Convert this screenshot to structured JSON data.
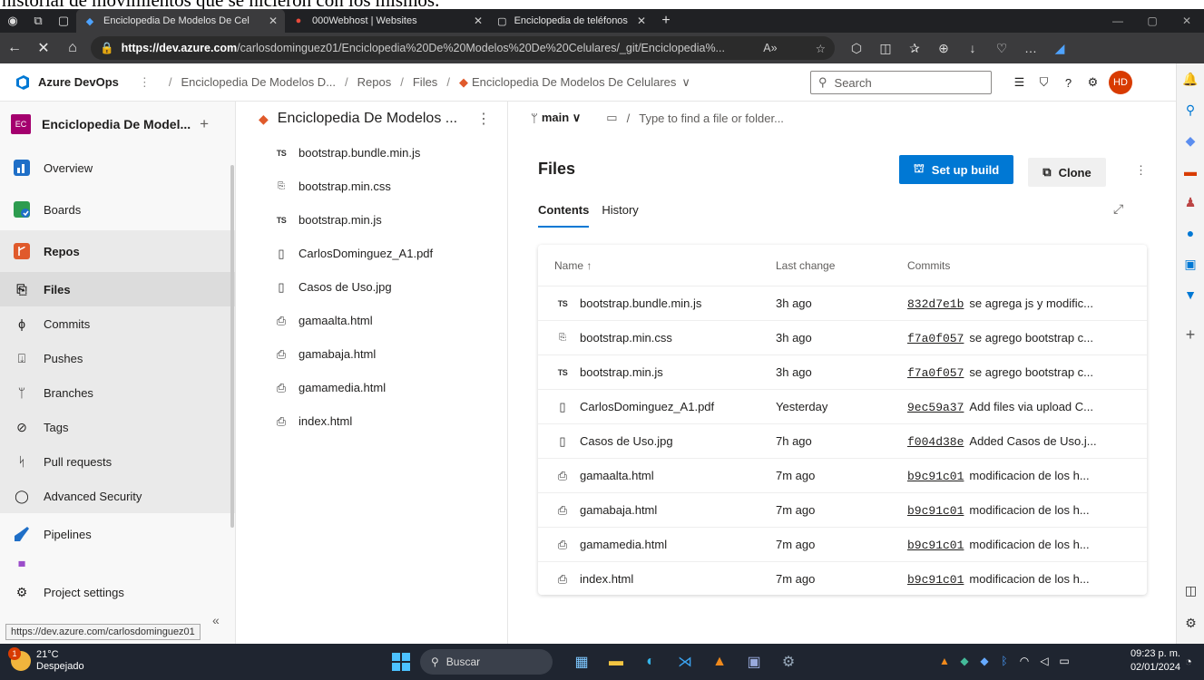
{
  "doc_strip": "historial de movimientos que se hicieron con los mismos.",
  "browser": {
    "tabs": [
      {
        "label": "Enciclopedia De Modelos De Cel"
      },
      {
        "label": "000Webhost | Websites"
      },
      {
        "label": "Enciclopedia de teléfonos"
      }
    ],
    "url_host": "https://dev.azure.com",
    "url_path": "/carlosdominguez01/Enciclopedia%20De%20Modelos%20De%20Celulares/_git/Enciclopedia%..."
  },
  "header": {
    "product": "Azure DevOps",
    "breadcrumb": [
      "Enciclopedia De Modelos D...",
      "Repos",
      "Files",
      "Enciclopedia De Modelos De Celulares"
    ],
    "search_placeholder": "Search",
    "avatar": "HD"
  },
  "sidebar": {
    "project_initials": "EC",
    "project_name": "Enciclopedia De Model...",
    "items": [
      {
        "label": "Overview"
      },
      {
        "label": "Boards"
      },
      {
        "label": "Repos"
      },
      {
        "label": "Files"
      },
      {
        "label": "Commits"
      },
      {
        "label": "Pushes"
      },
      {
        "label": "Branches"
      },
      {
        "label": "Tags"
      },
      {
        "label": "Pull requests"
      },
      {
        "label": "Advanced Security"
      },
      {
        "label": "Pipelines"
      }
    ],
    "settings": "Project settings",
    "tooltip": "https://dev.azure.com/carlosdominguez01"
  },
  "tree": {
    "repo_name": "Enciclopedia De Modelos ...",
    "files": [
      {
        "icon": "TS",
        "name": "bootstrap.bundle.min.js"
      },
      {
        "icon": "css",
        "name": "bootstrap.min.css"
      },
      {
        "icon": "TS",
        "name": "bootstrap.min.js"
      },
      {
        "icon": "file",
        "name": "CarlosDominguez_A1.pdf"
      },
      {
        "icon": "file",
        "name": "Casos de Uso.jpg"
      },
      {
        "icon": "html",
        "name": "gamaalta.html"
      },
      {
        "icon": "html",
        "name": "gamabaja.html"
      },
      {
        "icon": "html",
        "name": "gamamedia.html"
      },
      {
        "icon": "html",
        "name": "index.html"
      }
    ]
  },
  "main": {
    "branch": "main",
    "path_placeholder": "Type to find a file or folder...",
    "title": "Files",
    "setup_build": "Set up build",
    "clone": "Clone",
    "tabs": [
      "Contents",
      "History"
    ],
    "columns": [
      "Name ↑",
      "Last change",
      "Commits"
    ],
    "rows": [
      {
        "name": "bootstrap.bundle.min.js",
        "change": "3h ago",
        "hash": "832d7e1b",
        "msg": "se agrega js y modific..."
      },
      {
        "name": "bootstrap.min.css",
        "change": "3h ago",
        "hash": "f7a0f057",
        "msg": "se agrego bootstrap c..."
      },
      {
        "name": "bootstrap.min.js",
        "change": "3h ago",
        "hash": "f7a0f057",
        "msg": "se agrego bootstrap c..."
      },
      {
        "name": "CarlosDominguez_A1.pdf",
        "change": "Yesterday",
        "hash": "9ec59a37",
        "msg": "Add files via upload C..."
      },
      {
        "name": "Casos de Uso.jpg",
        "change": "7h ago",
        "hash": "f004d38e",
        "msg": "Added Casos de Uso.j..."
      },
      {
        "name": "gamaalta.html",
        "change": "7m ago",
        "hash": "b9c91c01",
        "msg": "modificacion de los h..."
      },
      {
        "name": "gamabaja.html",
        "change": "7m ago",
        "hash": "b9c91c01",
        "msg": "modificacion de los h..."
      },
      {
        "name": "gamamedia.html",
        "change": "7m ago",
        "hash": "b9c91c01",
        "msg": "modificacion de los h..."
      },
      {
        "name": "index.html",
        "change": "7m ago",
        "hash": "b9c91c01",
        "msg": "modificacion de los h..."
      }
    ]
  },
  "taskbar": {
    "temp": "21°C",
    "weather": "Despejado",
    "badge": "1",
    "search": "Buscar",
    "time": "09:23 p. m.",
    "date": "02/01/2024"
  },
  "colors": {
    "accent": "#0078d4",
    "avatar": "#d83b01",
    "project_tile": "#a4006e"
  }
}
